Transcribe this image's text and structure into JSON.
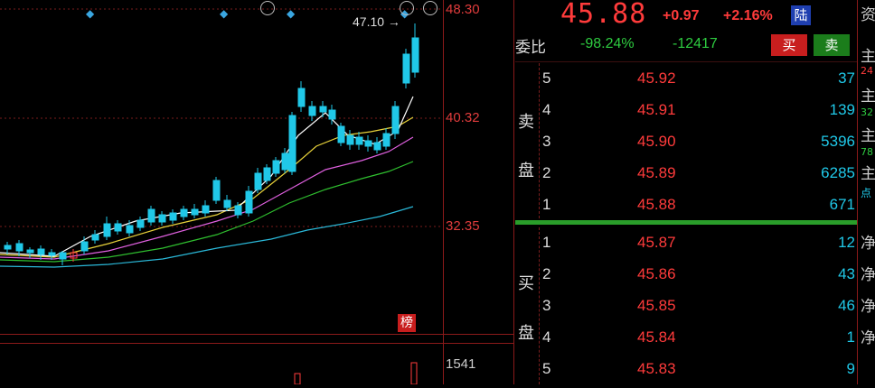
{
  "chart": {
    "axis_labels": [
      "48.30",
      "40.32",
      "32.35"
    ],
    "volume_label": "1541",
    "peak_label": "47.10",
    "badge": "榜"
  },
  "quote": {
    "price": "45.88",
    "change": "+0.97",
    "change_pct": "+2.16%",
    "market_tag": "陆",
    "weibi_label": "委比",
    "weibi_pct": "-98.24%",
    "weibi_diff": "-12417",
    "buy_button": "买",
    "sell_button": "卖",
    "sell_side_label": [
      "卖",
      "盘"
    ],
    "buy_side_label": [
      "买",
      "盘"
    ],
    "asks": [
      {
        "level": "5",
        "price": "45.92",
        "volume": "37"
      },
      {
        "level": "4",
        "price": "45.91",
        "volume": "139"
      },
      {
        "level": "3",
        "price": "45.90",
        "volume": "5396"
      },
      {
        "level": "2",
        "price": "45.89",
        "volume": "6285"
      },
      {
        "level": "1",
        "price": "45.88",
        "volume": "671"
      }
    ],
    "bids": [
      {
        "level": "1",
        "price": "45.87",
        "volume": "12"
      },
      {
        "level": "2",
        "price": "45.86",
        "volume": "43"
      },
      {
        "level": "3",
        "price": "45.85",
        "volume": "46"
      },
      {
        "level": "4",
        "price": "45.84",
        "volume": "1"
      },
      {
        "level": "5",
        "price": "45.83",
        "volume": "9"
      }
    ]
  },
  "strip": {
    "top_char": "资",
    "items": [
      "主",
      "24",
      "主",
      "32",
      "主",
      "78",
      "主",
      "点"
    ],
    "bottom_items": [
      "净",
      "净",
      "净",
      "净"
    ]
  },
  "colors": {
    "up": "#ff3b3b",
    "down": "#2ecc40",
    "cyan": "#20c8e8",
    "ma5": "#ffffff",
    "ma10": "#e8d23a",
    "ma20": "#e060e0",
    "ma30": "#2fbf2f",
    "ma60": "#2ab8d8"
  }
}
